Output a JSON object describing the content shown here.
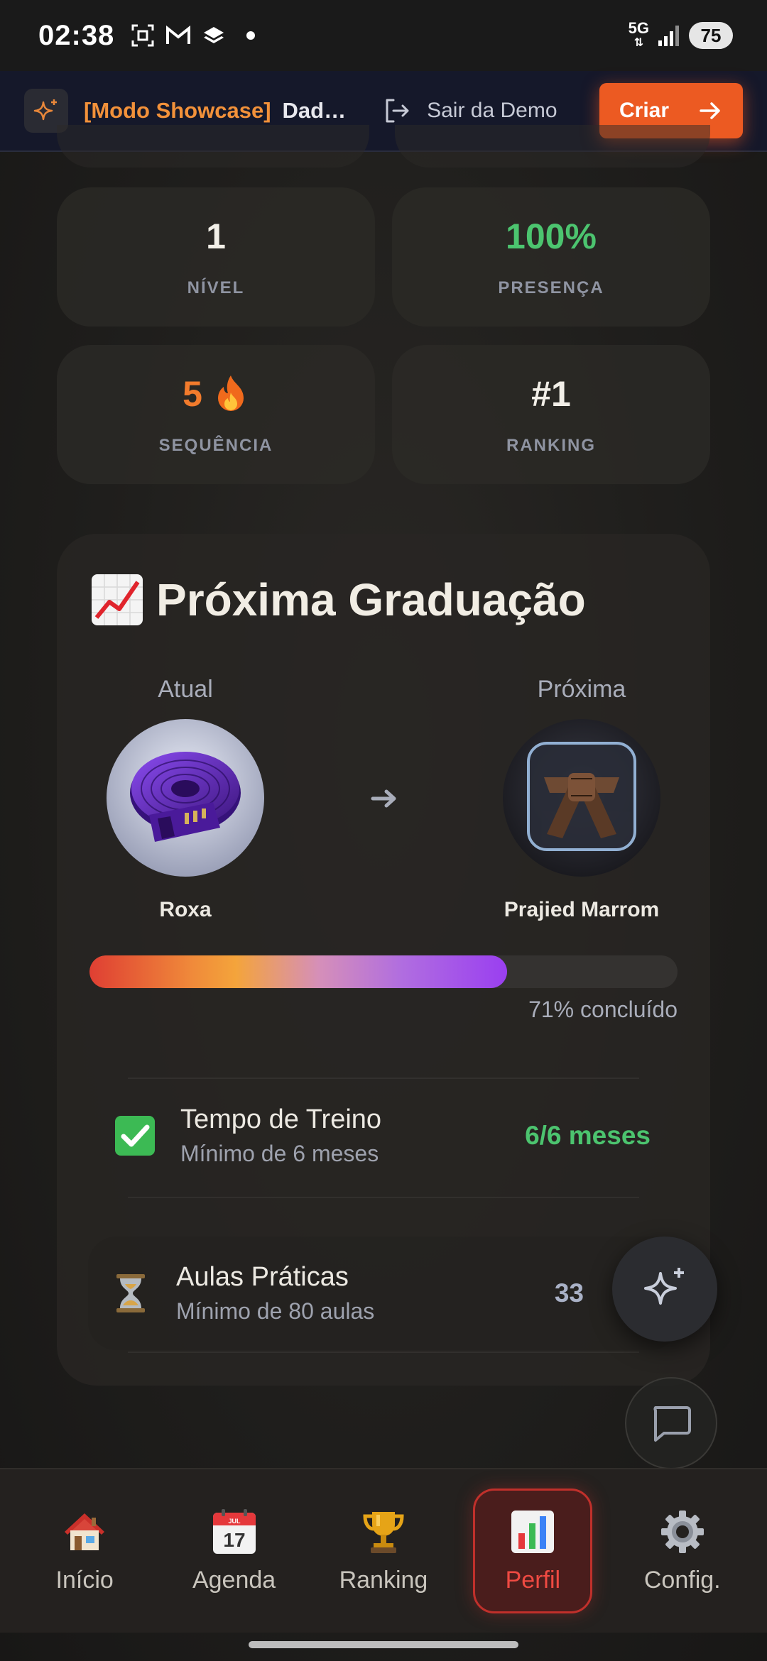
{
  "status_bar": {
    "time": "02:38",
    "network": "5G",
    "battery": "75"
  },
  "banner": {
    "mode_label": "[Modo Showcase]",
    "subtitle": "Dad…",
    "exit_label": "Sair da Demo",
    "create_label": "Criar"
  },
  "stats": [
    {
      "value": "1",
      "label": "NÍVEL",
      "color": "#f2efe8"
    },
    {
      "value": "100%",
      "label": "PRESENÇA",
      "color": "#4cc46f"
    },
    {
      "value": "5",
      "label": "SEQUÊNCIA",
      "color": "#f27b2c"
    },
    {
      "value": "#1",
      "label": "RANKING",
      "color": "#f2efe8"
    }
  ],
  "graduation": {
    "title": "Próxima Graduação",
    "current_caption": "Atual",
    "next_caption": "Próxima",
    "current_belt": "Roxa",
    "next_belt": "Prajied Marrom",
    "progress_percent": 71,
    "progress_label": "71% concluído",
    "requirements": [
      {
        "title": "Tempo de Treino",
        "subtitle": "Mínimo de 6 meses",
        "value": "6/6 meses",
        "color": "#4cc46f",
        "icon": "check-icon"
      },
      {
        "title": "Aulas Práticas",
        "subtitle": "Mínimo de 80 aulas",
        "value": "33",
        "color": "#a9b1c6",
        "icon": "hourglass-icon"
      }
    ]
  },
  "nav": [
    {
      "label": "Início",
      "icon": "home-icon",
      "active": false
    },
    {
      "label": "Agenda",
      "icon": "calendar-icon",
      "active": false
    },
    {
      "label": "Ranking",
      "icon": "trophy-icon",
      "active": false
    },
    {
      "label": "Perfil",
      "icon": "chart-icon",
      "active": true
    },
    {
      "label": "Config.",
      "icon": "gear-icon",
      "active": false
    }
  ],
  "calendar_icon": {
    "month": "JUL",
    "day": "17"
  }
}
